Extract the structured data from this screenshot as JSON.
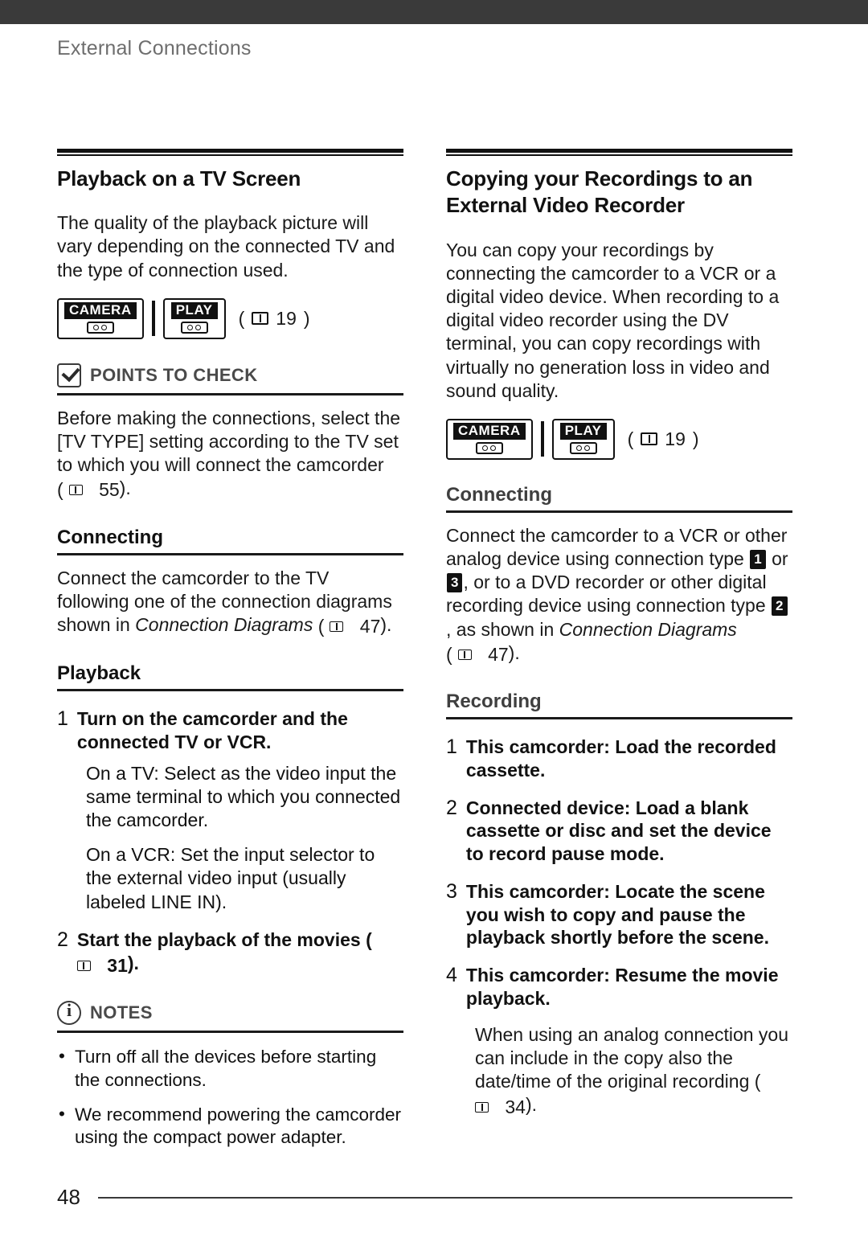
{
  "header": {
    "title": "External Connections"
  },
  "left": {
    "section_title": "Playback on a TV Screen",
    "intro": "The quality of the playback picture will vary depending on the connected TV and the type of connection used.",
    "badges": [
      {
        "label": "CAMERA",
        "icon": "camera-mode-icon"
      },
      {
        "label": "PLAY",
        "icon": "play-mode-icon"
      }
    ],
    "badge_pageref": "19",
    "points_to_check": {
      "heading": "POINTS TO CHECK",
      "icon": "checkbox-check-icon",
      "text_a": "Before making the connections, select the [TV TYPE] setting according to the TV set to which you will connect the camcorder",
      "text_pageref": "55",
      "text_b": ")."
    },
    "connecting": {
      "heading": "Connecting",
      "text_a": "Connect the camcorder to the TV following one of the connection diagrams shown in ",
      "text_italic": "Connection Diagrams",
      "text_pageref": "47",
      "text_b": ")."
    },
    "playback": {
      "heading": "Playback",
      "steps": [
        {
          "num": "1",
          "title": "Turn on the camcorder and the connected TV or VCR.",
          "sub": [
            "On a TV: Select as the video input the same terminal to which you connected the camcorder.",
            "On a VCR: Set the input selector to the external video input (usually labeled LINE IN)."
          ]
        },
        {
          "num": "2",
          "title_a": "Start the playback of the movies (",
          "title_pageref": "31",
          "title_b": ")."
        }
      ]
    },
    "notes": {
      "heading": "NOTES",
      "icon": "info-circle-icon",
      "items": [
        "Turn off all the devices before starting the connections.",
        "We recommend powering the camcorder using the compact power adapter."
      ]
    }
  },
  "right": {
    "section_title": "Copying your Recordings to an External Video Recorder",
    "intro": "You can copy your recordings by connecting the camcorder to a VCR or a digital video device. When recording to a digital video recorder using the DV terminal, you can copy recordings with virtually no generation loss in video and sound quality.",
    "badges": [
      {
        "label": "CAMERA",
        "icon": "camera-mode-icon"
      },
      {
        "label": "PLAY",
        "icon": "play-mode-icon"
      }
    ],
    "badge_pageref": "19",
    "connecting": {
      "heading": "Connecting",
      "text_a": "Connect the camcorder to a VCR or other analog device using connection type ",
      "type_1": "1",
      "text_or": " or ",
      "type_3": "3",
      "text_b": ", or to a DVD recorder or other digital recording device using connection type ",
      "type_2": "2",
      "text_c": ", as shown in ",
      "text_italic": "Connection Diagrams",
      "text_pageref": "47",
      "text_d": ")."
    },
    "recording": {
      "heading": "Recording",
      "steps": [
        {
          "num": "1",
          "title": "This camcorder: Load the recorded cassette."
        },
        {
          "num": "2",
          "title": "Connected device: Load a blank cassette or disc and set the device to record pause mode."
        },
        {
          "num": "3",
          "title": "This camcorder: Locate the scene you wish to copy and pause the playback shortly before the scene."
        },
        {
          "num": "4",
          "title": "This camcorder: Resume the movie playback."
        }
      ],
      "closing_a": "When using an analog connection you can include in the copy also the date/time of the original recording (",
      "closing_pageref": "34",
      "closing_b": ")."
    }
  },
  "footer": {
    "page_number": "48"
  }
}
